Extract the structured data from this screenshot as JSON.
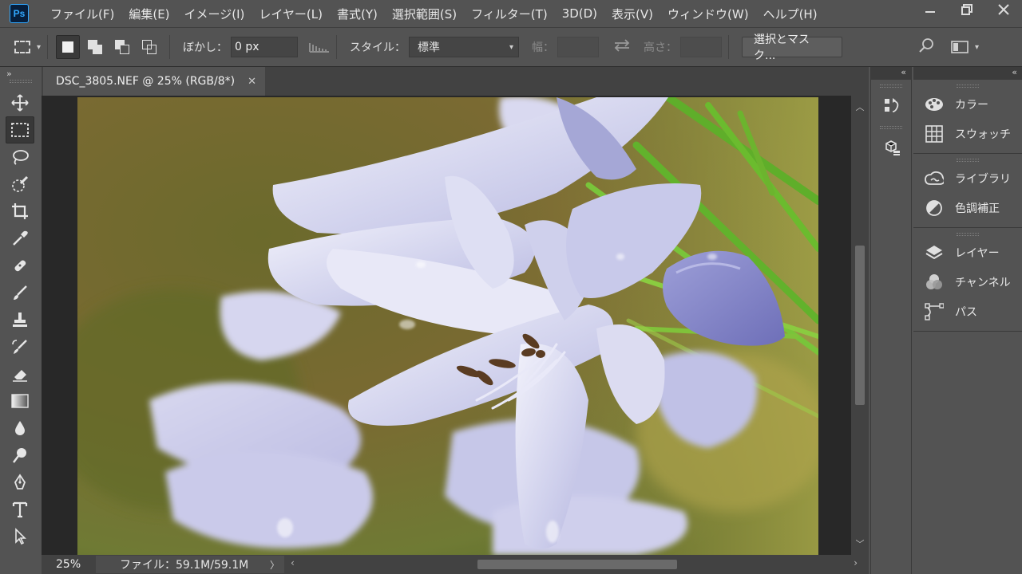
{
  "app": {
    "logo": "Ps"
  },
  "menu": [
    "ファイル(F)",
    "編集(E)",
    "イメージ(I)",
    "レイヤー(L)",
    "書式(Y)",
    "選択範囲(S)",
    "フィルター(T)",
    "3D(D)",
    "表示(V)",
    "ウィンドウ(W)",
    "ヘルプ(H)"
  ],
  "options": {
    "feather_label": "ぼかし：",
    "feather_value": "0 px",
    "style_label": "スタイル：",
    "style_value": "標準",
    "width_label": "幅：",
    "height_label": "高さ：",
    "select_mask_label": "選択とマスク..."
  },
  "document": {
    "tab_title": "DSC_3805.NEF @ 25% (RGB/8*)",
    "zoom": "25%",
    "file_info": "ファイル：59.1M/59.1M"
  },
  "panels": {
    "group1": [
      "カラー",
      "スウォッチ"
    ],
    "group2": [
      "ライブラリ",
      "色調補正"
    ],
    "group3": [
      "レイヤー",
      "チャンネル",
      "パス"
    ]
  },
  "colors": {
    "ui_bg": "#535353",
    "dark_bg": "#424242",
    "canvas_bg": "#282828",
    "ps_blue": "#31a8ff"
  }
}
